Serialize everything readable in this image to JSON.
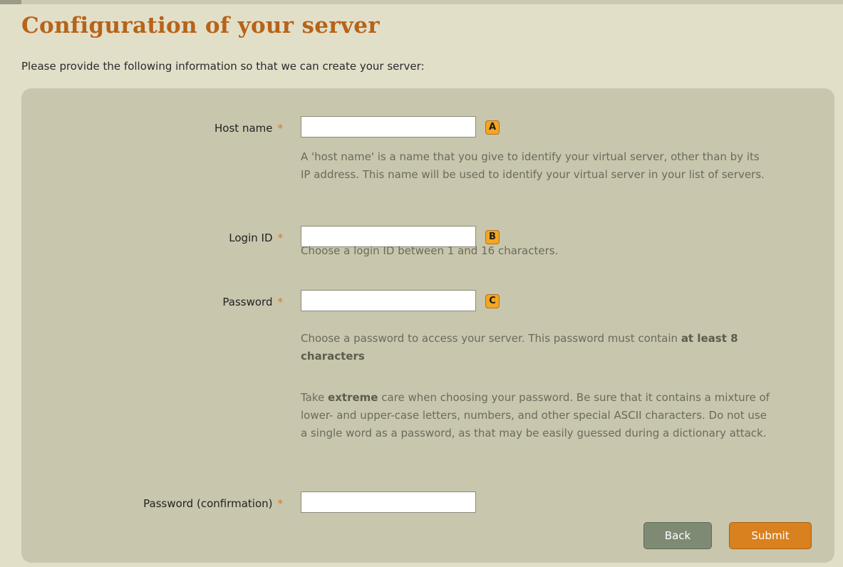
{
  "page": {
    "title": "Configuration of your server",
    "intro": "Please provide the following information so that we can create your server:"
  },
  "form": {
    "required_marker": "*",
    "host_name": {
      "label": "Host name",
      "value": "",
      "marker": "A",
      "help": "A 'host name' is a name that you give to identify your virtual server, other than by its IP address. This name will be used to identify your virtual server in your list of servers."
    },
    "login_id": {
      "label": "Login ID",
      "value": "",
      "marker": "B",
      "help": "Choose a login ID between 1 and 16 characters."
    },
    "password": {
      "label": "Password",
      "value": "",
      "marker": "C",
      "help1_prefix": "Choose a password to access your server. This password must contain",
      "help1_bold": "at least 8 characters",
      "help2_prefix": "Take",
      "help2_bold": "extreme",
      "help2_rest": "care when choosing your password. Be sure that it contains a mixture of lower- and upper-case letters, numbers, and other special ASCII characters. Do not use a single word as a password, as that may be easily guessed during a dictionary attack."
    },
    "password_confirmation": {
      "label": "Password (confirmation)",
      "value": ""
    }
  },
  "buttons": {
    "back": "Back",
    "submit": "Submit"
  },
  "colors": {
    "background": "#e2dfc9",
    "panel": "#c8c6ac",
    "title": "#b76318",
    "required": "#d37a2a",
    "marker": "#f2a624",
    "back_button": "#7e8a73",
    "submit_button": "#d9801f"
  }
}
